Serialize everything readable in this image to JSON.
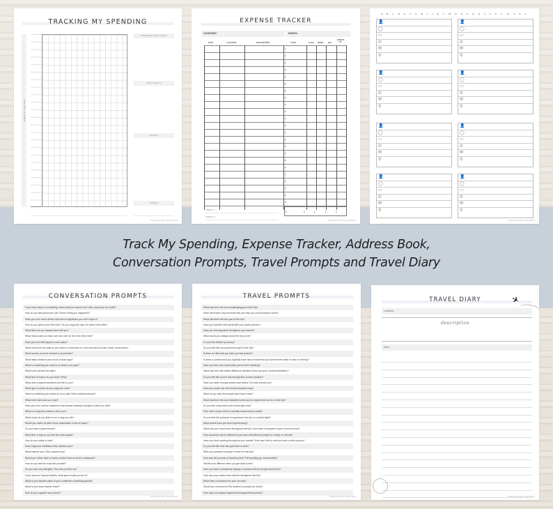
{
  "caption": {
    "line1": "Track My Spending, Expense Tracker, Address Book,",
    "line2": "Conversation Prompts, Travel Prompts and Travel Diary"
  },
  "colors": {
    "band": "#c8d0da",
    "page": "#ffffff",
    "label_fill": "#f0f0f0"
  },
  "tracking": {
    "title": "TRACKING MY SPENDING",
    "axis_label": "AMOUNT PER DAY",
    "sections": [
      "UNEXPECTED COSTS",
      "POST DAYS",
      "NOTES",
      "TOTAL"
    ],
    "footer": "Designed by Hello Lovely Planner"
  },
  "expense": {
    "title": "EXPENSE TRACKER",
    "category_label": "CATEGORY:",
    "month_label": "MONTH:",
    "columns": [
      "DATE",
      "LOCATION",
      "DESCRIPTION",
      "TOTAL",
      "CASH",
      "DEBIT",
      "BAL",
      "CREDIT CC"
    ],
    "currency_symbol": "$",
    "credit_rows": [
      "CREDIT cc:",
      "CREDIT cc:"
    ],
    "footer": "Designed by Hello Lovely Planner"
  },
  "address_book": {
    "alphabet": "A B C D E F G H I J K L M N O P Q R S T U V W X Y Z",
    "card_icons": [
      "person-icon",
      "birthday-icon",
      "mobile-icon",
      "phone-icon",
      "mail-icon",
      "location-pin-icon"
    ],
    "card_glyphs": [
      "👤",
      "◯",
      "▭",
      "✆",
      "✉",
      "⚲"
    ],
    "card_count": 8,
    "footer": "Designed by Hello Lovely Planner"
  },
  "conversation": {
    "title": "CONVERSATION PROMPTS",
    "items": [
      "If you had a day to do anything, what would you want to do? Who would you do it with?",
      "How do you feel about your job? Does it bring you happiness?",
      "Have you ever had a dream that was so significant you can't forget it?",
      "How do you spend your free time? Do you enjoy the way it is spent most often?",
      "What items do you always have with you?",
      "What meal could you have over and over for the rest of the time?",
      "Have you ever felt trapped in one place?",
      "What trend from the past do you want to come back to? and one that you hope never comes back?",
      "What food do you look forward to at potlucks?",
      "What helps enhance your mood on bad days?",
      "What is something you want to do before you pass?",
      "What is the perfect first date?",
      "What kind of humor do you have? Why?",
      "What does a typical weekend look like to you?",
      "What type of movie do you enjoy the most?",
      "What is something you would do if you didn't feel societal pressure?",
      "What is the last book you read?",
      "Have you ever had an experience that almost instantly changed a value you held?",
      "What is a song that means a lot to you?",
      "What music do you listen to on a long car ride?",
      "Would you rather be able to live underwater or live in space?",
      "Do you have a green thumb?",
      "What time of day do you feel the most awake?",
      "How do you relate to time?",
      "Does Yoga and meditation help destress you?",
      "What inspires you? Who inspires you?",
      "Would you rather have a home-cooked meal or eat at a restaurant?",
      "How do you feel the most like yourself?",
      "Do you have any allergies? How did you find out?",
      "If you were an Olympic Athlete, what sport would you be in?",
      "What is your favorite place to go to celebrate something special?",
      "What is your least favorite chore?",
      "How do you organize your phone?"
    ],
    "footer": "Designed by Hello Lovely Planner"
  },
  "travel_prompts": {
    "title": "TRAVEL PROMPTS",
    "items": [
      "What has been the most challenging part of the trip?",
      "Have there been any moments that you wish you could transport home?",
      "What has been the best part of the trip?",
      "Have you traveled well alone/with your travel partners?",
      "Have you felt supported throughout your travels?",
      "What would you change about the trip so far?",
      "Do you feel limited by money?",
      "Do you feel like you packed enough for this trip?",
      "Is there an item that you wish you had packed?",
      "Is there a comfort food you typically have had at home that you haven't been able to have on the trip?",
      "Have you tried new foods while you've been traveling?",
      "What has been the widest difference between home and your current destination?",
      "Do you feel like you've had enough time in each location?",
      "Have you taken enough photos and videos? Do they include you?",
      "Have you made any new friends along the way?",
      "What do you wish the people back home knew?",
      "What has been the most beautiful scene you've experienced so far on this trip?",
      "Do you feel connected to the world right now?",
      "How much of your time is currently consumed by media?",
      "Do you feel the pressure to experience this trip in a certain light?",
      "What smells have you been experiencing?",
      "What has your mood been throughout the trip? How does it compare to your mood at home?",
      "How would this trip be different if you were with different people ex: family vs. friends?",
      "Have you been working throughout your travels? How has it felt to work/not work on this journey?",
      "Do you feel like time has gone fast or slow?",
      "Were you prepared enough to leave for this trip?",
      "How was the process of traveling here? Did anything go unexpectedly?",
      "Will life look different when you get back home?",
      "Have you been consistently staying in contact with the people back home?",
      "How has your routine been altered throughout this trip?",
      "What have you learned for your next trip?",
      "Would you recommend this location to people you know?",
      "How have you stayed organized throughout this journey?"
    ],
    "footer": "Designed by Hello Lovely Planner"
  },
  "travel_diary": {
    "title": "TRAVEL DIARY",
    "location_label": "Location:",
    "description_label": "description",
    "date_label": "Date:",
    "footer": "Designed by Hello Lovely Planner"
  }
}
